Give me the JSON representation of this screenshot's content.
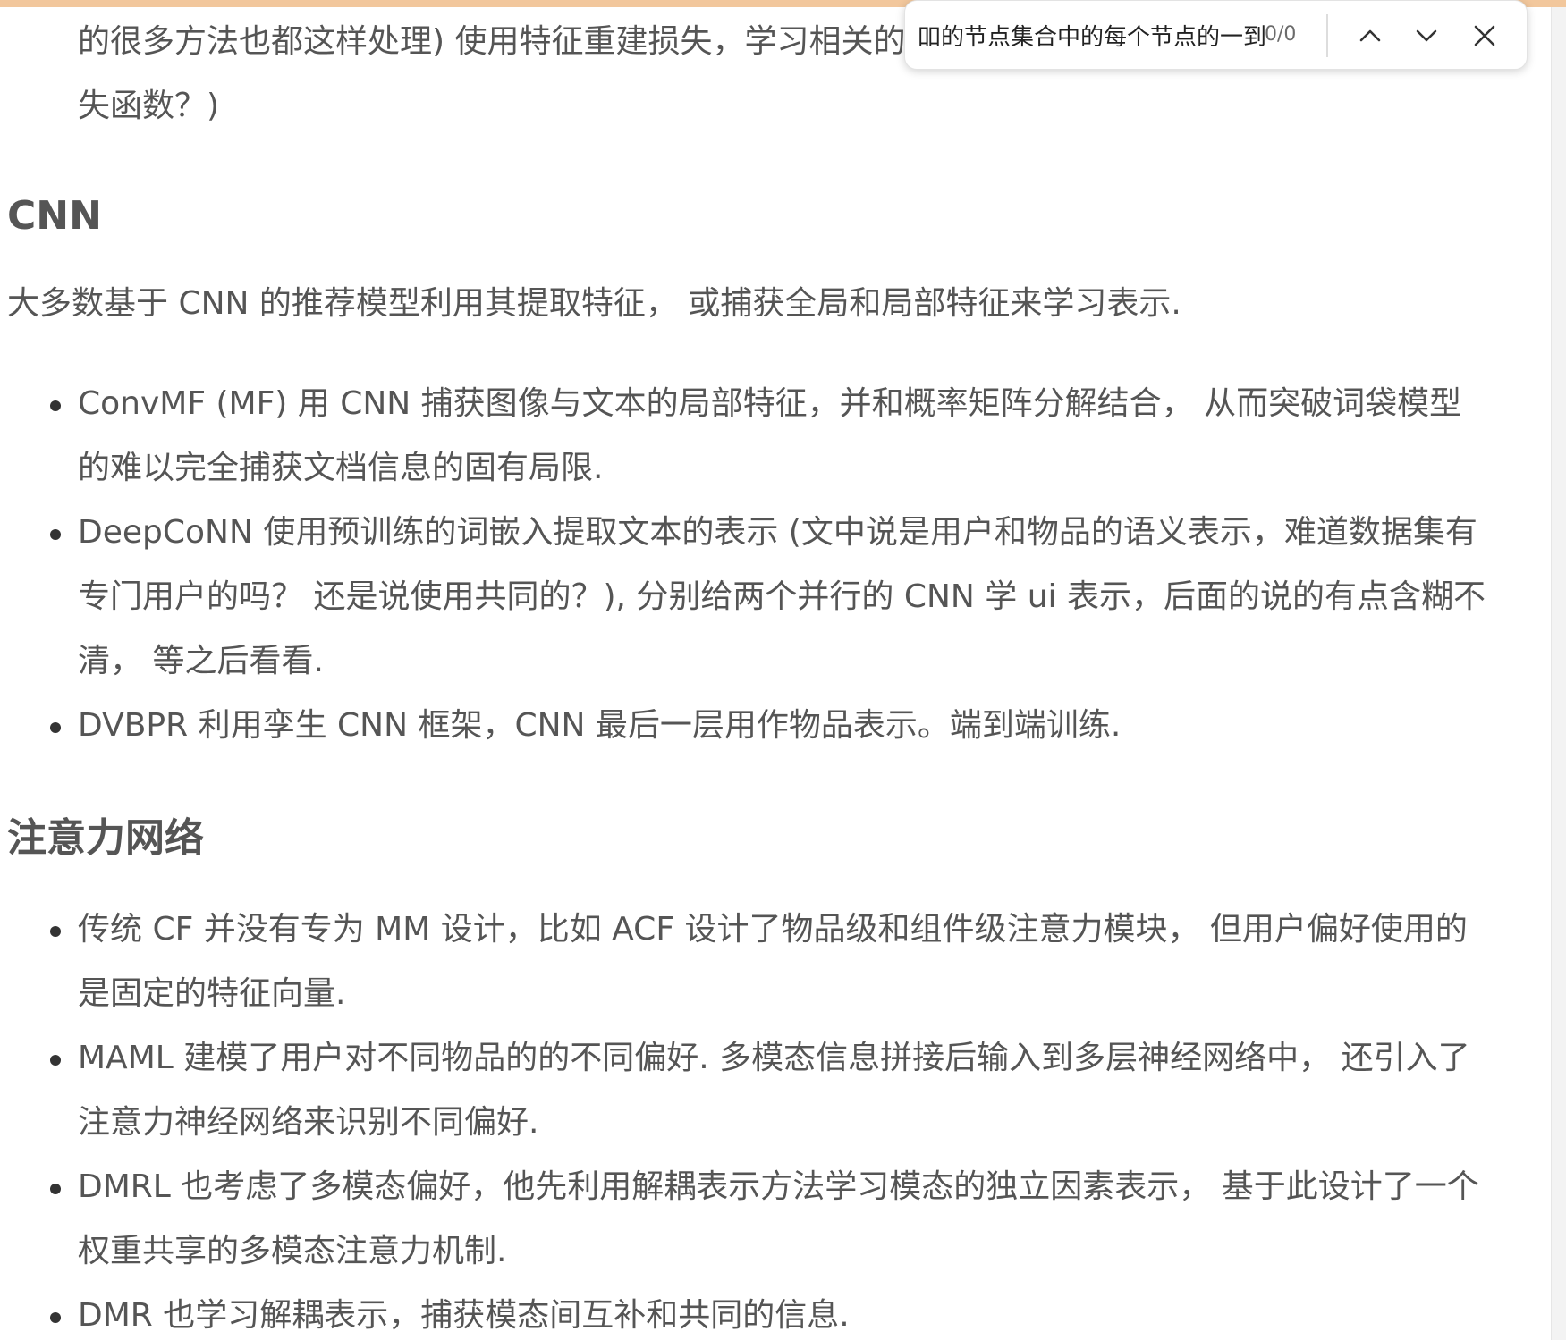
{
  "find_bar": {
    "query": "吅的节点集合中的每个节点的一到中",
    "match_count": "0/0",
    "prev_icon": "chevron-up-icon",
    "next_icon": "chevron-down-icon",
    "close_icon": "close-icon"
  },
  "document": {
    "intro_fragment": {
      "line1": "的很多方法也都这样处理) 使用特征重建损失，学习相关的",
      "line2": "失函数？)"
    },
    "cnn_section": {
      "title": "CNN",
      "paragraph": "大多数基于 CNN 的推荐模型利用其提取特征， 或捕获全局和局部特征来学习表示.",
      "items": [
        {
          "line1": "ConvMF (MF) 用 CNN 捕获图像与文本的局部特征，并和概率矩阵分解结合， 从而突破词袋模型",
          "line2": "的难以完全捕获文档信息的固有局限."
        },
        {
          "line1": "DeepCoNN 使用预训练的词嵌入提取文本的表示 (文中说是用户和物品的语义表示，难道数据集有",
          "line2": "专门用户的吗？ 还是说使用共同的？), 分别给两个并行的 CNN 学 ui 表示，后面的说的有点含糊不",
          "line3": "清， 等之后看看."
        },
        {
          "line1": "DVBPR 利用孪生 CNN 框架，CNN 最后一层用作物品表示。端到端训练."
        }
      ]
    },
    "attention_section": {
      "title": "注意力网络",
      "items": [
        {
          "line1": "传统 CF 并没有专为 MM 设计，比如 ACF 设计了物品级和组件级注意力模块， 但用户偏好使用的",
          "line2": "是固定的特征向量."
        },
        {
          "line1": "MAML 建模了用户对不同物品的的不同偏好. 多模态信息拼接后输入到多层神经网络中， 还引入了",
          "line2": "注意力神经网络来识别不同偏好."
        },
        {
          "line1": "DMRL 也考虑了多模态偏好，他先利用解耦表示方法学习模态的独立因素表示， 基于此设计了一个",
          "line2": "权重共享的多模态注意力机制."
        },
        {
          "line1": "DMR 也学习解耦表示，捕获模态间互补和共同的信息."
        }
      ]
    }
  }
}
